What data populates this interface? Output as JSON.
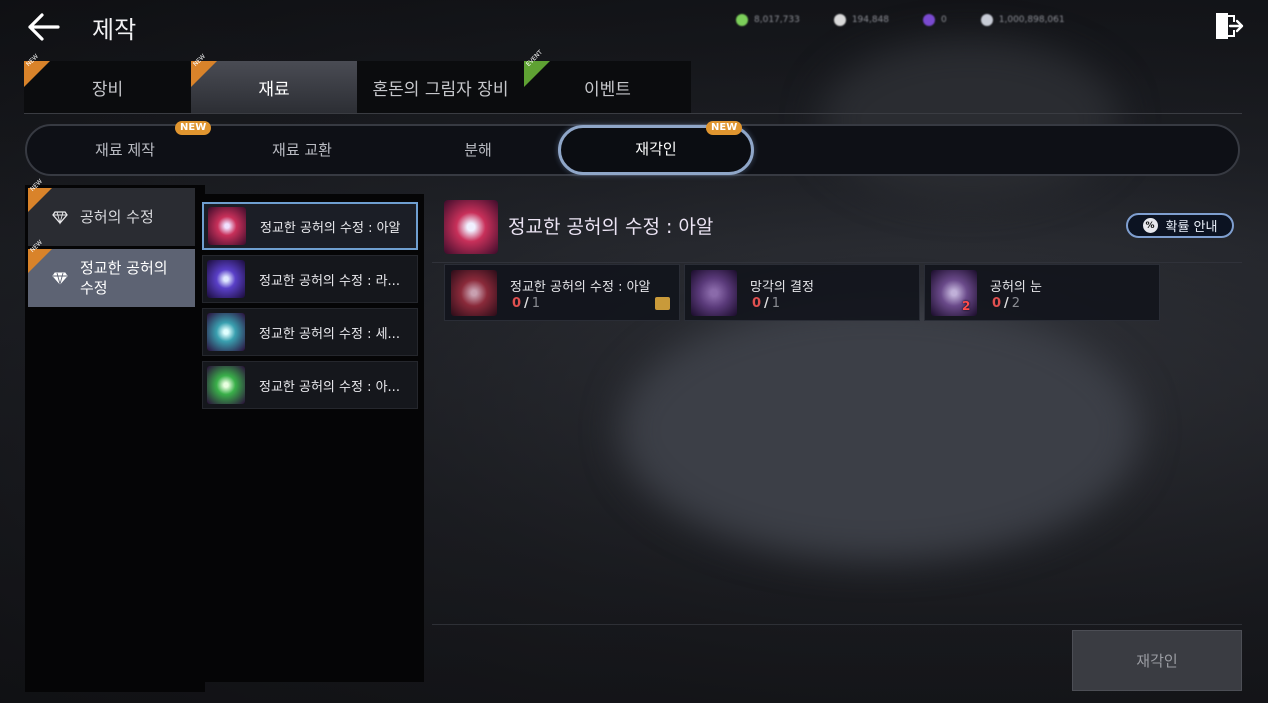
{
  "header": {
    "title": "제작",
    "currencies": [
      {
        "icon": "green-gem-icon",
        "value": "8,017,733",
        "color": "#7ccf5a"
      },
      {
        "icon": "white-coin-icon",
        "value": "194,848",
        "color": "#d9d9d9"
      },
      {
        "icon": "purple-crystal-icon",
        "value": "0",
        "color": "#7a4ad0"
      },
      {
        "icon": "silver-coin-icon",
        "value": "1,000,898,061",
        "color": "#c8ccd6"
      }
    ]
  },
  "main_tabs": [
    {
      "label": "장비",
      "badge": "NEW"
    },
    {
      "label": "재료",
      "badge": "NEW",
      "active": true
    },
    {
      "label": "혼돈의 그림자 장비"
    },
    {
      "label": "이벤트",
      "badge": "EVENT"
    }
  ],
  "sub_tabs": [
    {
      "label": "재료 제작",
      "badge": "NEW"
    },
    {
      "label": "재료 교환"
    },
    {
      "label": "분해"
    },
    {
      "label": "재각인",
      "badge": "NEW",
      "active": true
    }
  ],
  "categories": [
    {
      "label": "공허의 수정",
      "badge": "NEW",
      "icon": "diamond-icon"
    },
    {
      "label": "정교한 공허의 수정",
      "badge": "NEW",
      "icon": "diamond-icon",
      "active": true
    }
  ],
  "items": [
    {
      "label": "정교한 공허의 수정 : 아알",
      "color": "#c8305a",
      "active": true
    },
    {
      "label": "정교한 공허의 수정 : 라...",
      "color": "#5a40c8"
    },
    {
      "label": "정교한 공허의 수정 : 세...",
      "color": "#3aa0b0"
    },
    {
      "label": "정교한 공허의 수정 : 아...",
      "color": "#3ab04a"
    }
  ],
  "detail": {
    "title": "정교한 공허의 수정 : 아알",
    "prob_button": "확률 안내",
    "materials": [
      {
        "name": "정교한 공허의 수정 : 아알",
        "have": "0",
        "need": "1",
        "color": "#8a2a3a"
      },
      {
        "name": "망각의 결정",
        "have": "0",
        "need": "1",
        "color": "#5a3a7a"
      },
      {
        "name": "공허의 눈",
        "have": "0",
        "need": "2",
        "color": "#6a4a8a",
        "badge": "2"
      }
    ],
    "action_button": "재각인"
  }
}
